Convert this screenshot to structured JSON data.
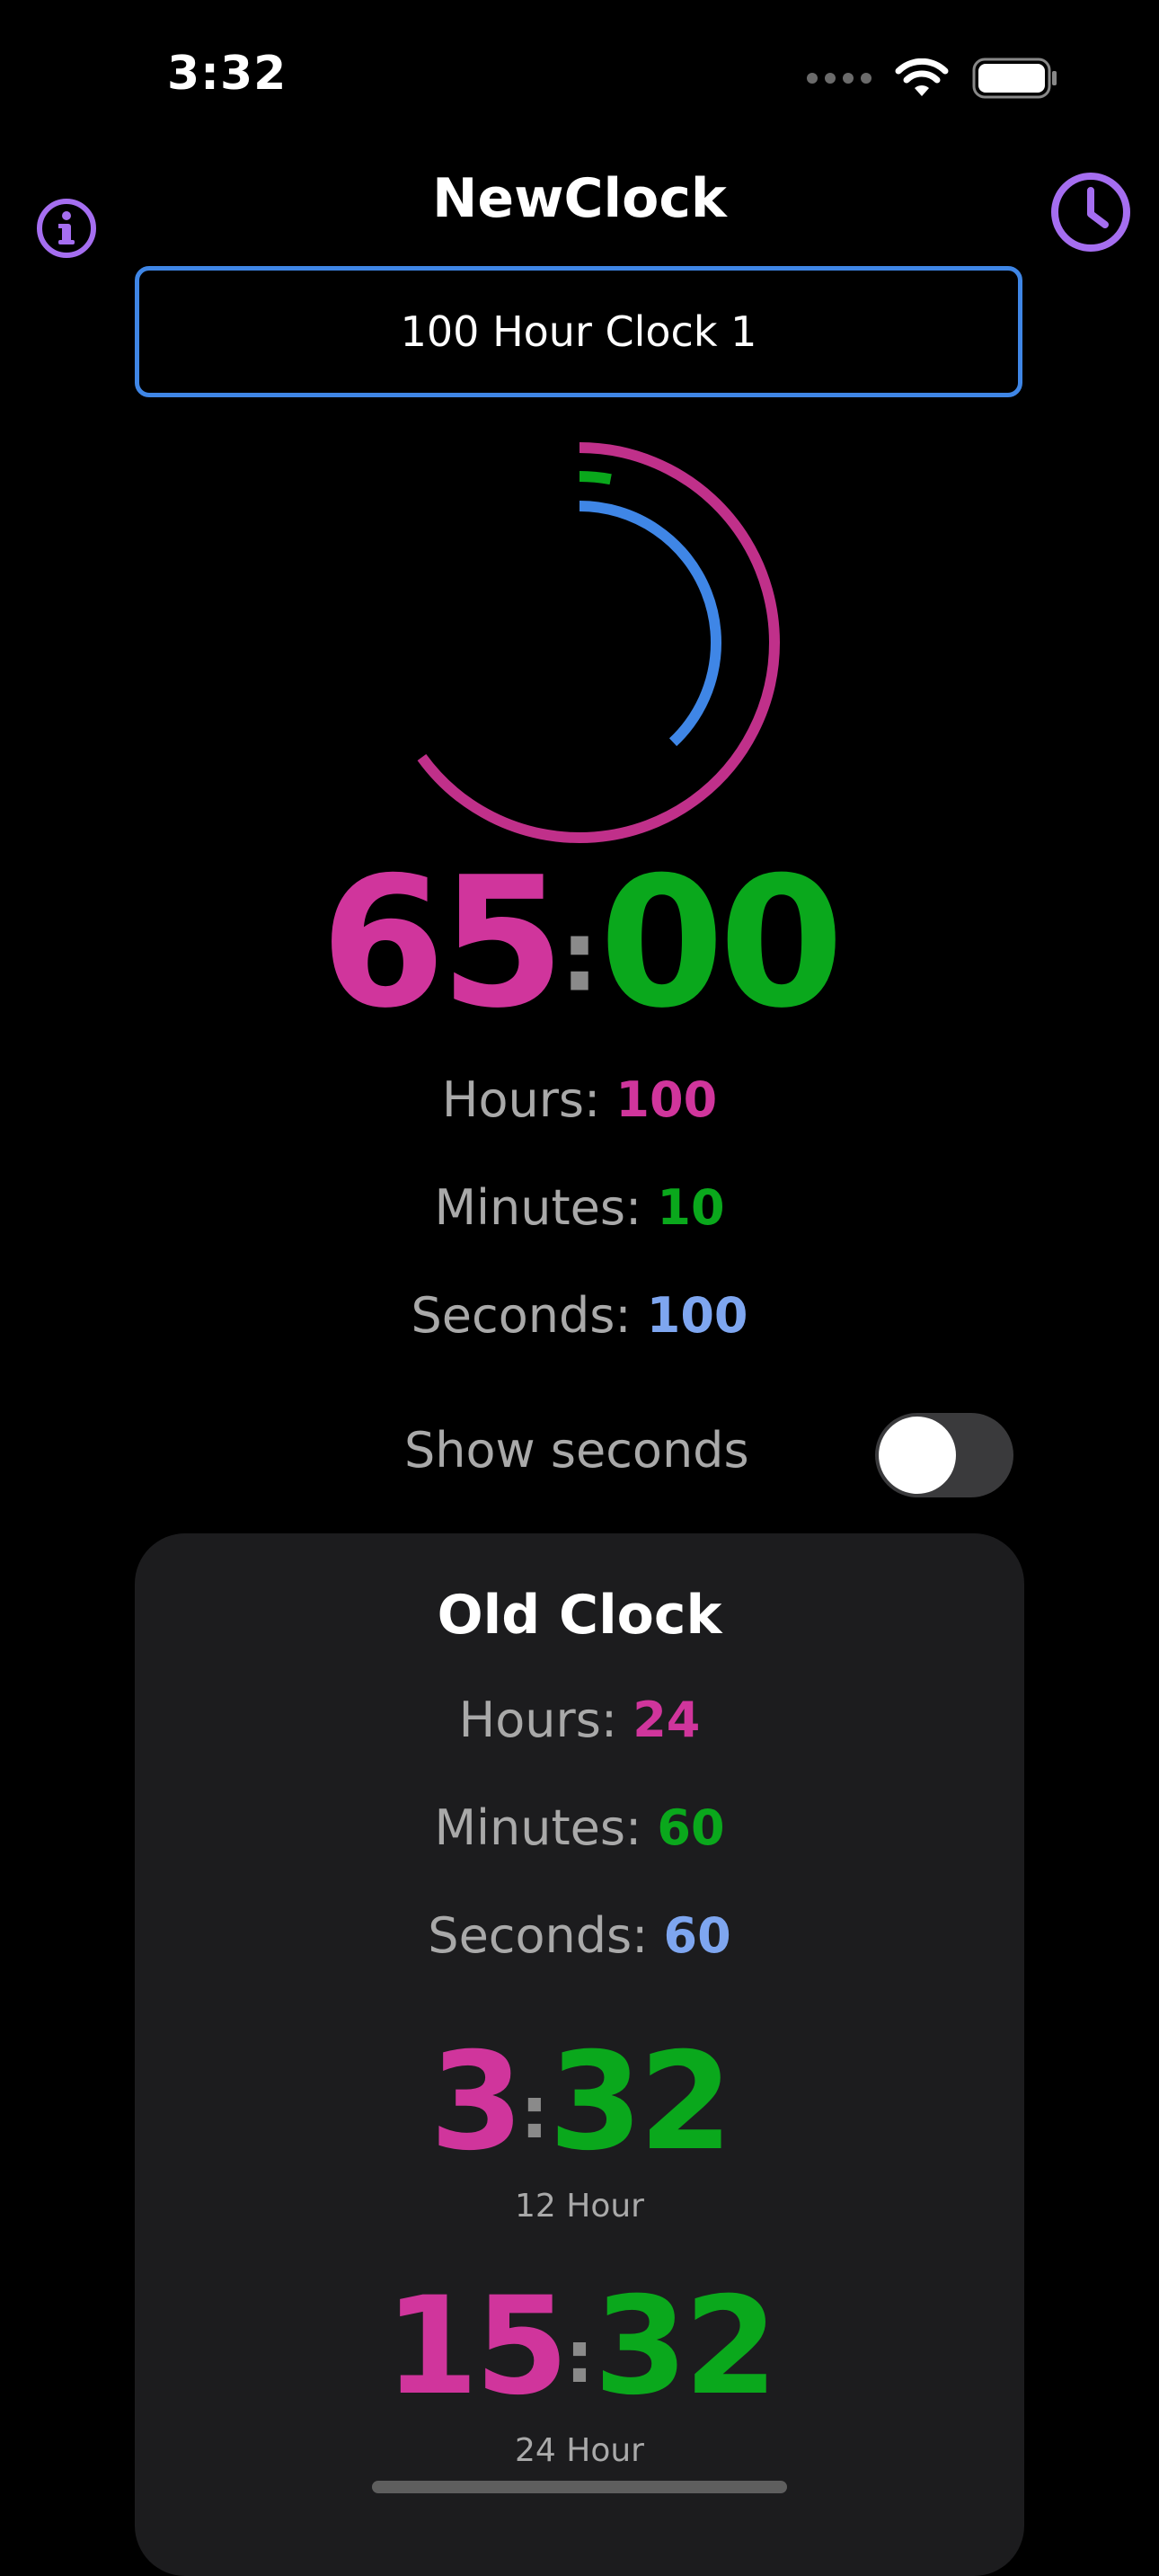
{
  "status_bar": {
    "time": "3:32"
  },
  "header": {
    "title": "NewClock",
    "info_icon": "info-icon",
    "clock_icon": "clock-icon",
    "accent_color": "#a56ef0"
  },
  "selector": {
    "value": "100 Hour Clock 1"
  },
  "new_clock": {
    "hours_value": "65",
    "minutes_value": "00",
    "separator": ":",
    "hours_label": "Hours:",
    "hours_count": "100",
    "minutes_label": "Minutes:",
    "minutes_count": "10",
    "seconds_label": "Seconds:",
    "seconds_count": "100",
    "rings": {
      "hours_progress": 0.65,
      "minutes_progress": 0.0,
      "seconds_progress": 0.38,
      "hours_color": "#c0308a",
      "minutes_color": "#0aa81c",
      "seconds_color": "#3f86e6"
    }
  },
  "toggle": {
    "label": "Show seconds",
    "on": false
  },
  "old_clock": {
    "title": "Old Clock",
    "hours_label": "Hours:",
    "hours_count": "24",
    "minutes_label": "Minutes:",
    "minutes_count": "60",
    "seconds_label": "Seconds:",
    "seconds_count": "60",
    "twelve": {
      "hours": "3",
      "minutes": "32",
      "caption": "12 Hour"
    },
    "twentyfour": {
      "hours": "15",
      "minutes": "32",
      "caption": "24 Hour"
    }
  },
  "colors": {
    "pink": "#d0359c",
    "green": "#0aa81c",
    "blue": "#7ea6f0",
    "selector_border": "#3f86e6"
  }
}
